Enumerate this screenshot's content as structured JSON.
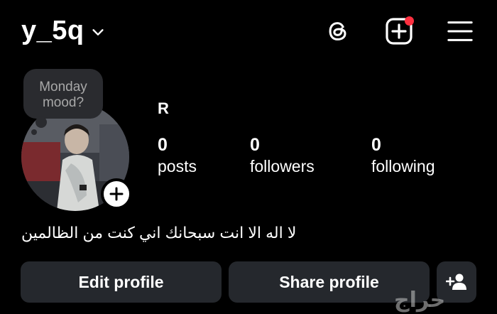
{
  "header": {
    "username": "y_5q",
    "icons": [
      "chevron-down-icon",
      "threads-icon",
      "create-post-icon",
      "menu-icon"
    ],
    "notification_color": "#ff3040"
  },
  "note": {
    "text": "Monday mood?"
  },
  "profile": {
    "display_name": "R",
    "stats": [
      {
        "value": "0",
        "label": "posts"
      },
      {
        "value": "0",
        "label": "followers"
      },
      {
        "value": "0",
        "label": "following"
      }
    ],
    "bio": "لا اله الا انت سبحانك اني كنت من الظالمين"
  },
  "actions": {
    "edit_label": "Edit profile",
    "share_label": "Share profile"
  },
  "watermark": "حراج",
  "colors": {
    "background": "#000000",
    "button": "#25282d",
    "note_bubble": "#2a2b2f"
  }
}
